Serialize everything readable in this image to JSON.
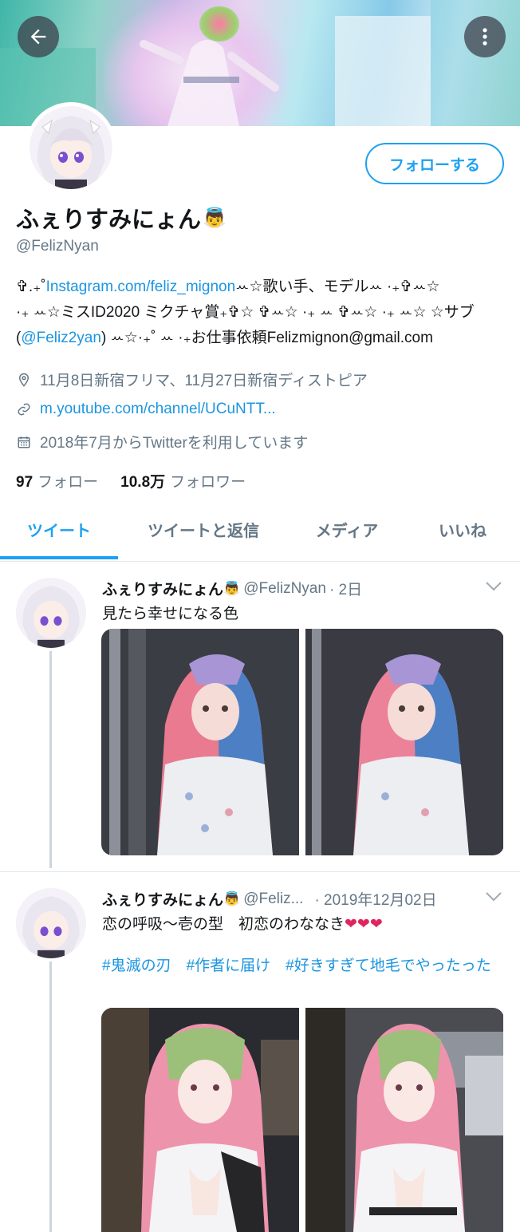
{
  "profile": {
    "display_name": "ふぇりすみにょん",
    "name_emoji": "👼",
    "handle": "@FelizNyan",
    "follow_label": "フォローする",
    "bio_line1_prefix": "✞.₊˚",
    "bio_line1_link": "Instagram.com/feliz_mignon",
    "bio_line1_suffix": "ꕀ☆歌い手、モデルꕀ ·₊✞ꕀ☆",
    "bio_line2": "·₊ ꕀ☆ミスID2020 ミクチャ賞₊✞☆ ✞ꕀ☆ ·₊ ꕀ ✞ꕀ☆ ·₊ ꕀ☆ ☆サブ",
    "bio_line3_prefix": "(",
    "bio_line3_link": "@Feliz2yan",
    "bio_line3_suffix": ") ꕀ☆·₊˚ ꕀ ·₊お仕事依頼Felizmignon@gmail.com",
    "location": "11月8日新宿フリマ、11月27日新宿ディストピア",
    "website": "m.youtube.com/channel/UCuNTT...",
    "joined": "2018年7月からTwitterを利用しています",
    "following_count": "97",
    "following_label": "フォロー",
    "followers_count": "10.8万",
    "followers_label": "フォロワー"
  },
  "tabs": [
    {
      "label": "ツイート",
      "active": true
    },
    {
      "label": "ツイートと返信",
      "active": false
    },
    {
      "label": "メディア",
      "active": false
    },
    {
      "label": "いいね",
      "active": false
    }
  ],
  "tweets": [
    {
      "name": "ふぇりすみにょん",
      "emoji": "👼",
      "handle": "@FelizNyan",
      "time": "· 2日",
      "text": "見たら幸せになる色"
    },
    {
      "name": "ふぇりすみにょん",
      "emoji": "👼",
      "handle": "@Feliz...",
      "time": "· 2019年12月02日",
      "text": "恋の呼吸〜壱の型　初恋のわななき",
      "hearts": "❤❤❤",
      "tags": "#鬼滅の刃　#作者に届け　#好きすぎて地毛でやったった"
    }
  ],
  "icons": {
    "back": "arrow-left-icon",
    "more": "more-vertical-icon",
    "location": "location-pin-icon",
    "link": "link-icon",
    "calendar": "calendar-icon",
    "chevron": "chevron-down-icon"
  },
  "colors": {
    "accent": "#1da1f2",
    "link": "#1b95e0",
    "muted": "#657786",
    "text": "#14171a",
    "divider": "#e1e8ed"
  }
}
